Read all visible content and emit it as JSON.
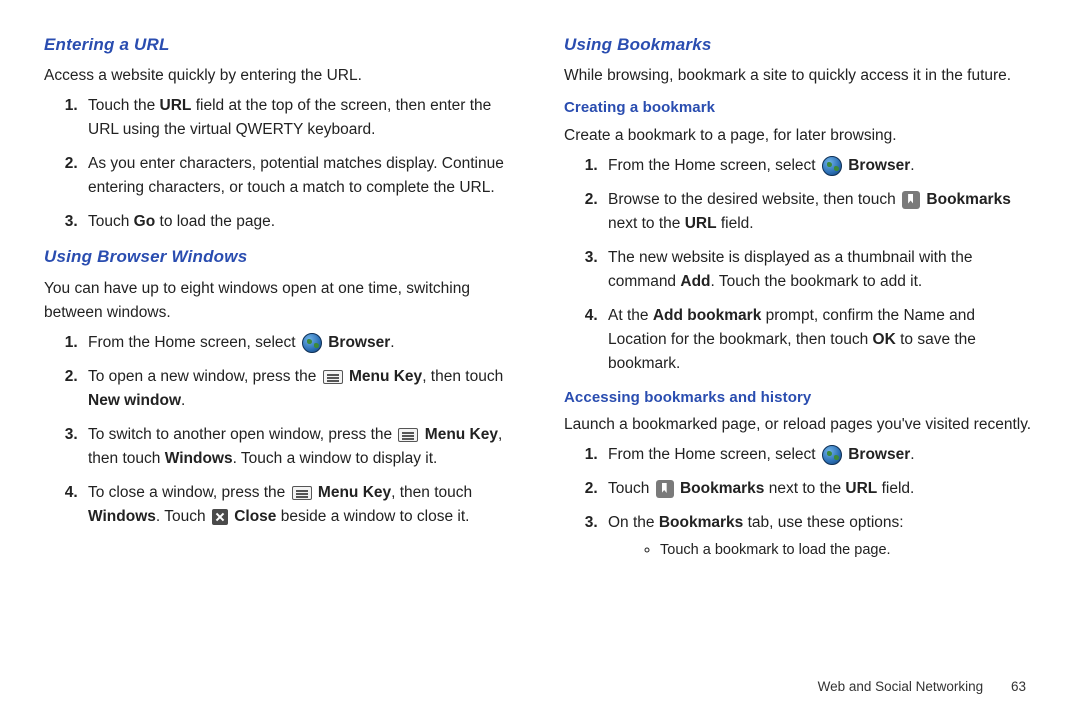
{
  "left": {
    "h1": "Entering a URL",
    "intro1": "Access a website quickly by entering the URL.",
    "s1a": "Touch the ",
    "s1b": "URL",
    "s1c": " field at the top of the screen, then enter the URL using the virtual QWERTY keyboard.",
    "s2": "As you enter characters, potential matches display. Continue entering characters, or touch a match to complete the URL.",
    "s3a": "Touch ",
    "s3b": "Go",
    "s3c": " to load the page.",
    "h2": "Using Browser Windows",
    "intro2": "You can have up to eight windows open at one time, switching between windows.",
    "w1a": "From the Home screen, select ",
    "w1b": "Browser",
    "w1c": ".",
    "w2a": "To open a new window, press the ",
    "w2b": "Menu Key",
    "w2c": ", then touch ",
    "w2d": "New window",
    "w2e": ".",
    "w3a": "To switch to another open window, press the ",
    "w3b": "Menu Key",
    "w3c": ", then touch ",
    "w3d": "Windows",
    "w3e": ". Touch a window to display it.",
    "w4a": "To close a window, press the ",
    "w4b": "Menu Key",
    "w4c": ", then touch ",
    "w4d": "Windows",
    "w4e": ". Touch ",
    "w4f": "Close",
    "w4g": " beside a window to close it."
  },
  "right": {
    "h1": "Using Bookmarks",
    "intro1": "While browsing, bookmark a site to quickly access it in the future.",
    "h2": "Creating a bookmark",
    "intro2": "Create a bookmark to a page, for later browsing.",
    "c1a": "From the Home screen, select ",
    "c1b": "Browser",
    "c1c": ".",
    "c2a": "Browse to the desired website, then touch ",
    "c2b": "Bookmarks",
    "c2c": " next to the ",
    "c2d": "URL",
    "c2e": " field.",
    "c3a": "The new website is displayed as a thumbnail with the command ",
    "c3b": "Add",
    "c3c": ". Touch the bookmark to add it.",
    "c4a": "At the ",
    "c4b": "Add bookmark",
    "c4c": " prompt, confirm the Name and Location for the bookmark, then touch ",
    "c4d": "OK",
    "c4e": " to save the bookmark.",
    "h3": "Accessing bookmarks and history",
    "intro3": "Launch a bookmarked page, or reload pages you've visited recently.",
    "a1a": "From the Home screen, select ",
    "a1b": "Browser",
    "a1c": ".",
    "a2a": "Touch ",
    "a2b": "Bookmarks",
    "a2c": " next to the ",
    "a2d": "URL",
    "a2e": " field.",
    "a3a": "On the ",
    "a3b": "Bookmarks",
    "a3c": " tab, use these options:",
    "bul1": "Touch a bookmark to load the page."
  },
  "footer": {
    "section": "Web and Social Networking",
    "page": "63"
  }
}
